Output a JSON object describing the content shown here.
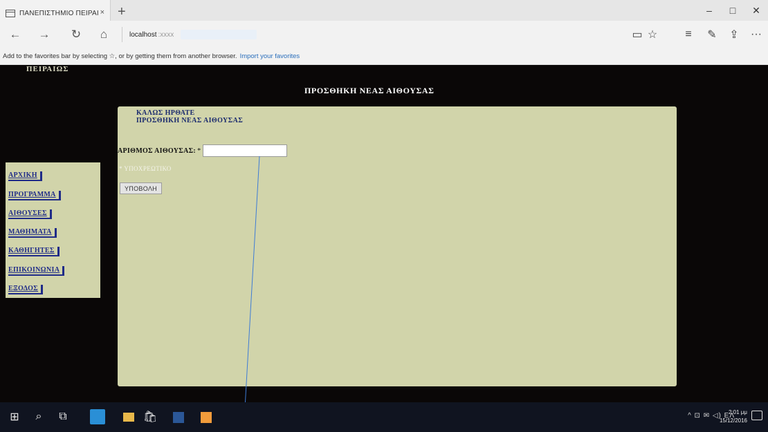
{
  "browser": {
    "tab_title": "ΠΑΝΕΠΙΣΤΗΜΙΟ ΠΕΙΡΑΙ",
    "tab_close": "×",
    "new_tab": "+",
    "address_host": "localhost",
    "address_rest": ":xxxx",
    "favorites_text": "Add to the favorites bar by selecting ☆, or by getting them from another browser.",
    "favorites_link": "Import your favorites",
    "nav": {
      "back": "←",
      "forward": "→",
      "refresh": "↻",
      "home": "⌂"
    },
    "tools": {
      "reading": "▭",
      "favorite": "☆",
      "hub": "≡",
      "notes": "✎",
      "share": "⇪",
      "more": "···"
    },
    "window": {
      "minimize": "–",
      "maximize": "□",
      "close": "✕"
    }
  },
  "page": {
    "brand": "ΠΕΙΡΑΙΩΣ",
    "heading": "ΠΡΟΣΘΗΚΗ ΝΕΑΣ ΑΙΘΟΥΣΑΣ",
    "welcome_line1": "ΚΑΛΩΣ ΗΡΘΑΤΕ",
    "welcome_line2": "ΠΡΟΣΘΗΚΗ ΝΕΑΣ ΑΙΘΟΥΣΑΣ",
    "form": {
      "room_label": "ΑΡΙΘΜΟΣ ΑΙΘΟΥΣΑΣ:",
      "required_mark": "*",
      "room_value": "",
      "required_note": "* ΥΠΟΧΡΕΩΤΙΚΟ",
      "submit_label": "ΥΠΟΒΟΛΗ"
    },
    "menu": [
      "ΑΡΧΙΚΗ",
      "ΠΡΟΓΡΑΜΜΑ",
      "ΑΙΘΟΥΣΕΣ",
      "ΜΑΘΗΜΑΤΑ",
      "ΚΑΘΗΓΗΤΕΣ",
      "ΕΠΙΚΟΙΝΩΝΙΑ",
      "ΕΞΟΔΟΣ"
    ]
  },
  "taskbar": {
    "start": "⊞",
    "search": "⌕",
    "task_view": "⧉",
    "store": "🛍",
    "tray": "^ ⊡ ✉ ◁) ΕΛ",
    "time": "2:01 μμ",
    "date": "15/12/2016"
  },
  "colors": {
    "page_bg": "#0a0707",
    "panel_bg": "#d1d4aa",
    "menu_link": "#1f2b88",
    "welcome_text": "#1a2a6e",
    "annotation_line": "#3d7bd6"
  }
}
